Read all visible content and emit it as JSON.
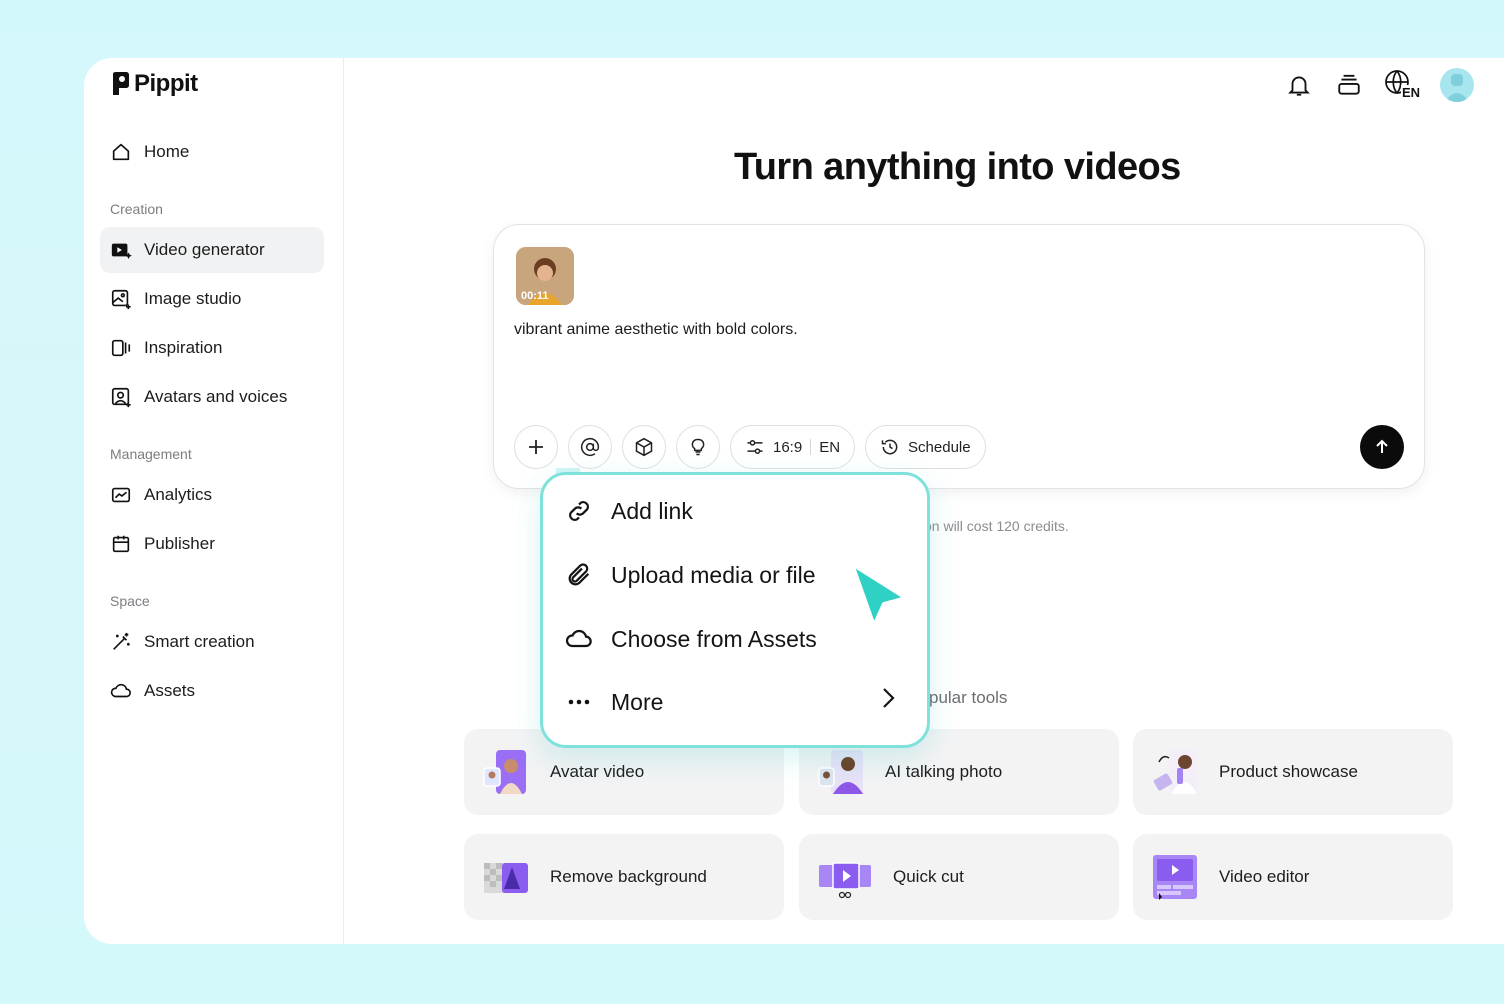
{
  "brand": {
    "name": "Pippit"
  },
  "sidebar": {
    "home": "Home",
    "sections": [
      {
        "label": "Creation"
      },
      {
        "label": "Management"
      },
      {
        "label": "Space"
      }
    ],
    "items": [
      {
        "label": "Video generator",
        "active": true
      },
      {
        "label": "Image studio"
      },
      {
        "label": "Inspiration"
      },
      {
        "label": "Avatars and voices"
      },
      {
        "label": "Analytics"
      },
      {
        "label": "Publisher"
      },
      {
        "label": "Smart creation"
      },
      {
        "label": "Assets"
      }
    ]
  },
  "topbar": {
    "language": "EN"
  },
  "main": {
    "headline": "Turn anything into videos",
    "prompt": {
      "thumbnail_duration": "00:11",
      "text": "vibrant anime aesthetic with bold colors.",
      "aspect_ratio": "16:9",
      "language": "EN",
      "schedule_label": "Schedule"
    },
    "credits_note": "on will cost 120 credits.",
    "popular_label": "pular tools"
  },
  "menu": {
    "items": [
      {
        "label": "Add link"
      },
      {
        "label": "Upload media or file"
      },
      {
        "label": "Choose from Assets"
      },
      {
        "label": "More"
      }
    ]
  },
  "tools": [
    {
      "label": "Avatar video"
    },
    {
      "label": "AI talking photo"
    },
    {
      "label": "Product showcase"
    },
    {
      "label": "Remove background"
    },
    {
      "label": "Quick cut"
    },
    {
      "label": "Video editor"
    }
  ],
  "colors": {
    "accent": "#7ee1dc",
    "cursor": "#2fd1c5",
    "purple": "#8a5cf0"
  }
}
